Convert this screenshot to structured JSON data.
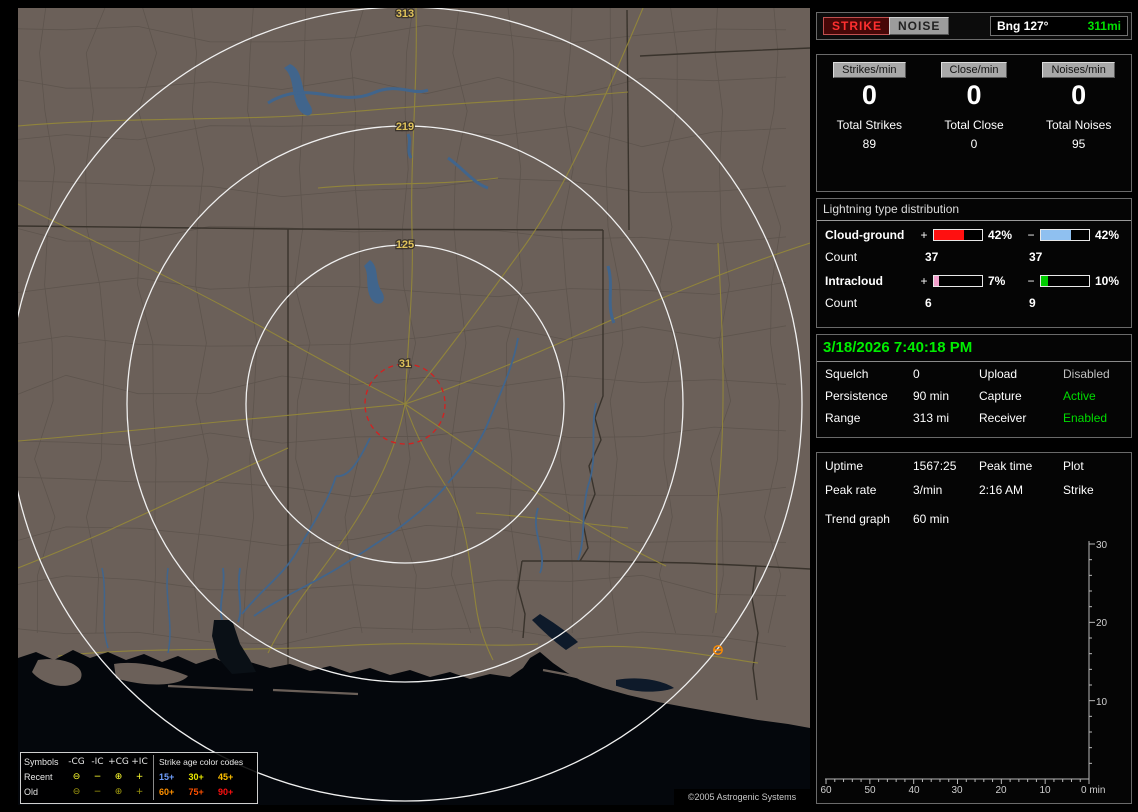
{
  "top_bar": {
    "strike_button": "STRIKE",
    "noise_button": "NOISE",
    "bearing_label": "Bng 127°",
    "bearing_range": "311mi",
    "range_color": "#00e000"
  },
  "counters": {
    "columns": [
      {
        "rate_label": "Strikes/min",
        "rate_value": "0",
        "total_label": "Total Strikes",
        "total_value": "89"
      },
      {
        "rate_label": "Close/min",
        "rate_value": "0",
        "total_label": "Total Close",
        "total_value": "0"
      },
      {
        "rate_label": "Noises/min",
        "rate_value": "0",
        "total_label": "Total Noises",
        "total_value": "95"
      }
    ]
  },
  "distribution": {
    "title": "Lightning type distribution",
    "plus_sign": "+",
    "minus_sign": "−",
    "rows": [
      {
        "name": "Cloud-ground",
        "plus_pct": "42%",
        "plus_color": "#ff1010",
        "minus_pct": "42%",
        "minus_color": "#8fc0f0",
        "count_label": "Count",
        "plus_count": "37",
        "minus_count": "37"
      },
      {
        "name": "Intracloud",
        "plus_pct": "7%",
        "plus_color": "#f2a0cc",
        "minus_pct": "10%",
        "minus_color": "#00cc00",
        "count_label": "Count",
        "plus_count": "6",
        "minus_count": "9"
      }
    ]
  },
  "status": {
    "datetime": "3/18/2026 7:40:18 PM",
    "datetime_color": "#00ee00",
    "rows": [
      {
        "label1": "Squelch",
        "value1": "0",
        "label2": "Upload",
        "value2": "Disabled",
        "value2_color": "#c0c0c0"
      },
      {
        "label1": "Persistence",
        "value1": "90 min",
        "label2": "Capture",
        "value2": "Active",
        "value2_color": "#00dd00"
      },
      {
        "label1": "Range",
        "value1": "313 mi",
        "label2": "Receiver",
        "value2": "Enabled",
        "value2_color": "#00dd00"
      }
    ]
  },
  "stats": {
    "rows": [
      {
        "c1": "Uptime",
        "c2": "1567:25",
        "c3": "Peak time",
        "c4": "Plot"
      },
      {
        "c1": "Peak rate",
        "c2": "3/min",
        "c3": "2:16 AM",
        "c4": "Strike"
      }
    ],
    "trend_label": "Trend graph",
    "trend_window": "60 min"
  },
  "trend_graph": {
    "y_ticks": [
      "30",
      "20",
      "10"
    ],
    "x_ticks": [
      "60",
      "50",
      "40",
      "30",
      "20",
      "10"
    ],
    "x_end_label": "0 min"
  },
  "map": {
    "range_labels": [
      "313",
      "219",
      "125",
      "31"
    ],
    "copyright": "©2005 Astrogenic Systems",
    "strike_marker_color": "#ff8c00"
  },
  "legend": {
    "symbols_header": "Symbols",
    "symbol_cols": [
      "-CG",
      "-IC",
      "+CG",
      "+IC"
    ],
    "age_header": "Strike age color codes",
    "glyphs": [
      "⊖",
      "−",
      "⊕",
      "+"
    ],
    "rows": [
      {
        "label": "Recent",
        "symbol_color": "#ffff30",
        "ages": [
          {
            "label": "15+",
            "color": "#6f9fff"
          },
          {
            "label": "30+",
            "color": "#e8e800"
          },
          {
            "label": "45+",
            "color": "#ffc000"
          }
        ]
      },
      {
        "label": "Old",
        "symbol_color": "#a09a10",
        "ages": [
          {
            "label": "60+",
            "color": "#ff9000"
          },
          {
            "label": "75+",
            "color": "#ff5000"
          },
          {
            "label": "90+",
            "color": "#ff1010"
          }
        ]
      }
    ]
  }
}
